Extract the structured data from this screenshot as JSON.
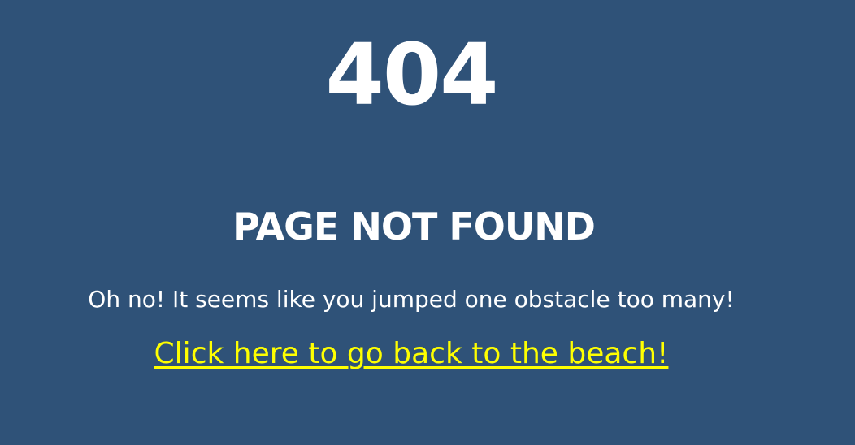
{
  "error_code": "404",
  "heading": "PAGE NOT FOUND",
  "message": "Oh no! It seems like you jumped one obstacle too many!",
  "back_link": {
    "label": "Click here to go back to the beach!"
  },
  "colors": {
    "background": "#2f5278",
    "text": "#ffffff",
    "link": "#ffff00"
  }
}
